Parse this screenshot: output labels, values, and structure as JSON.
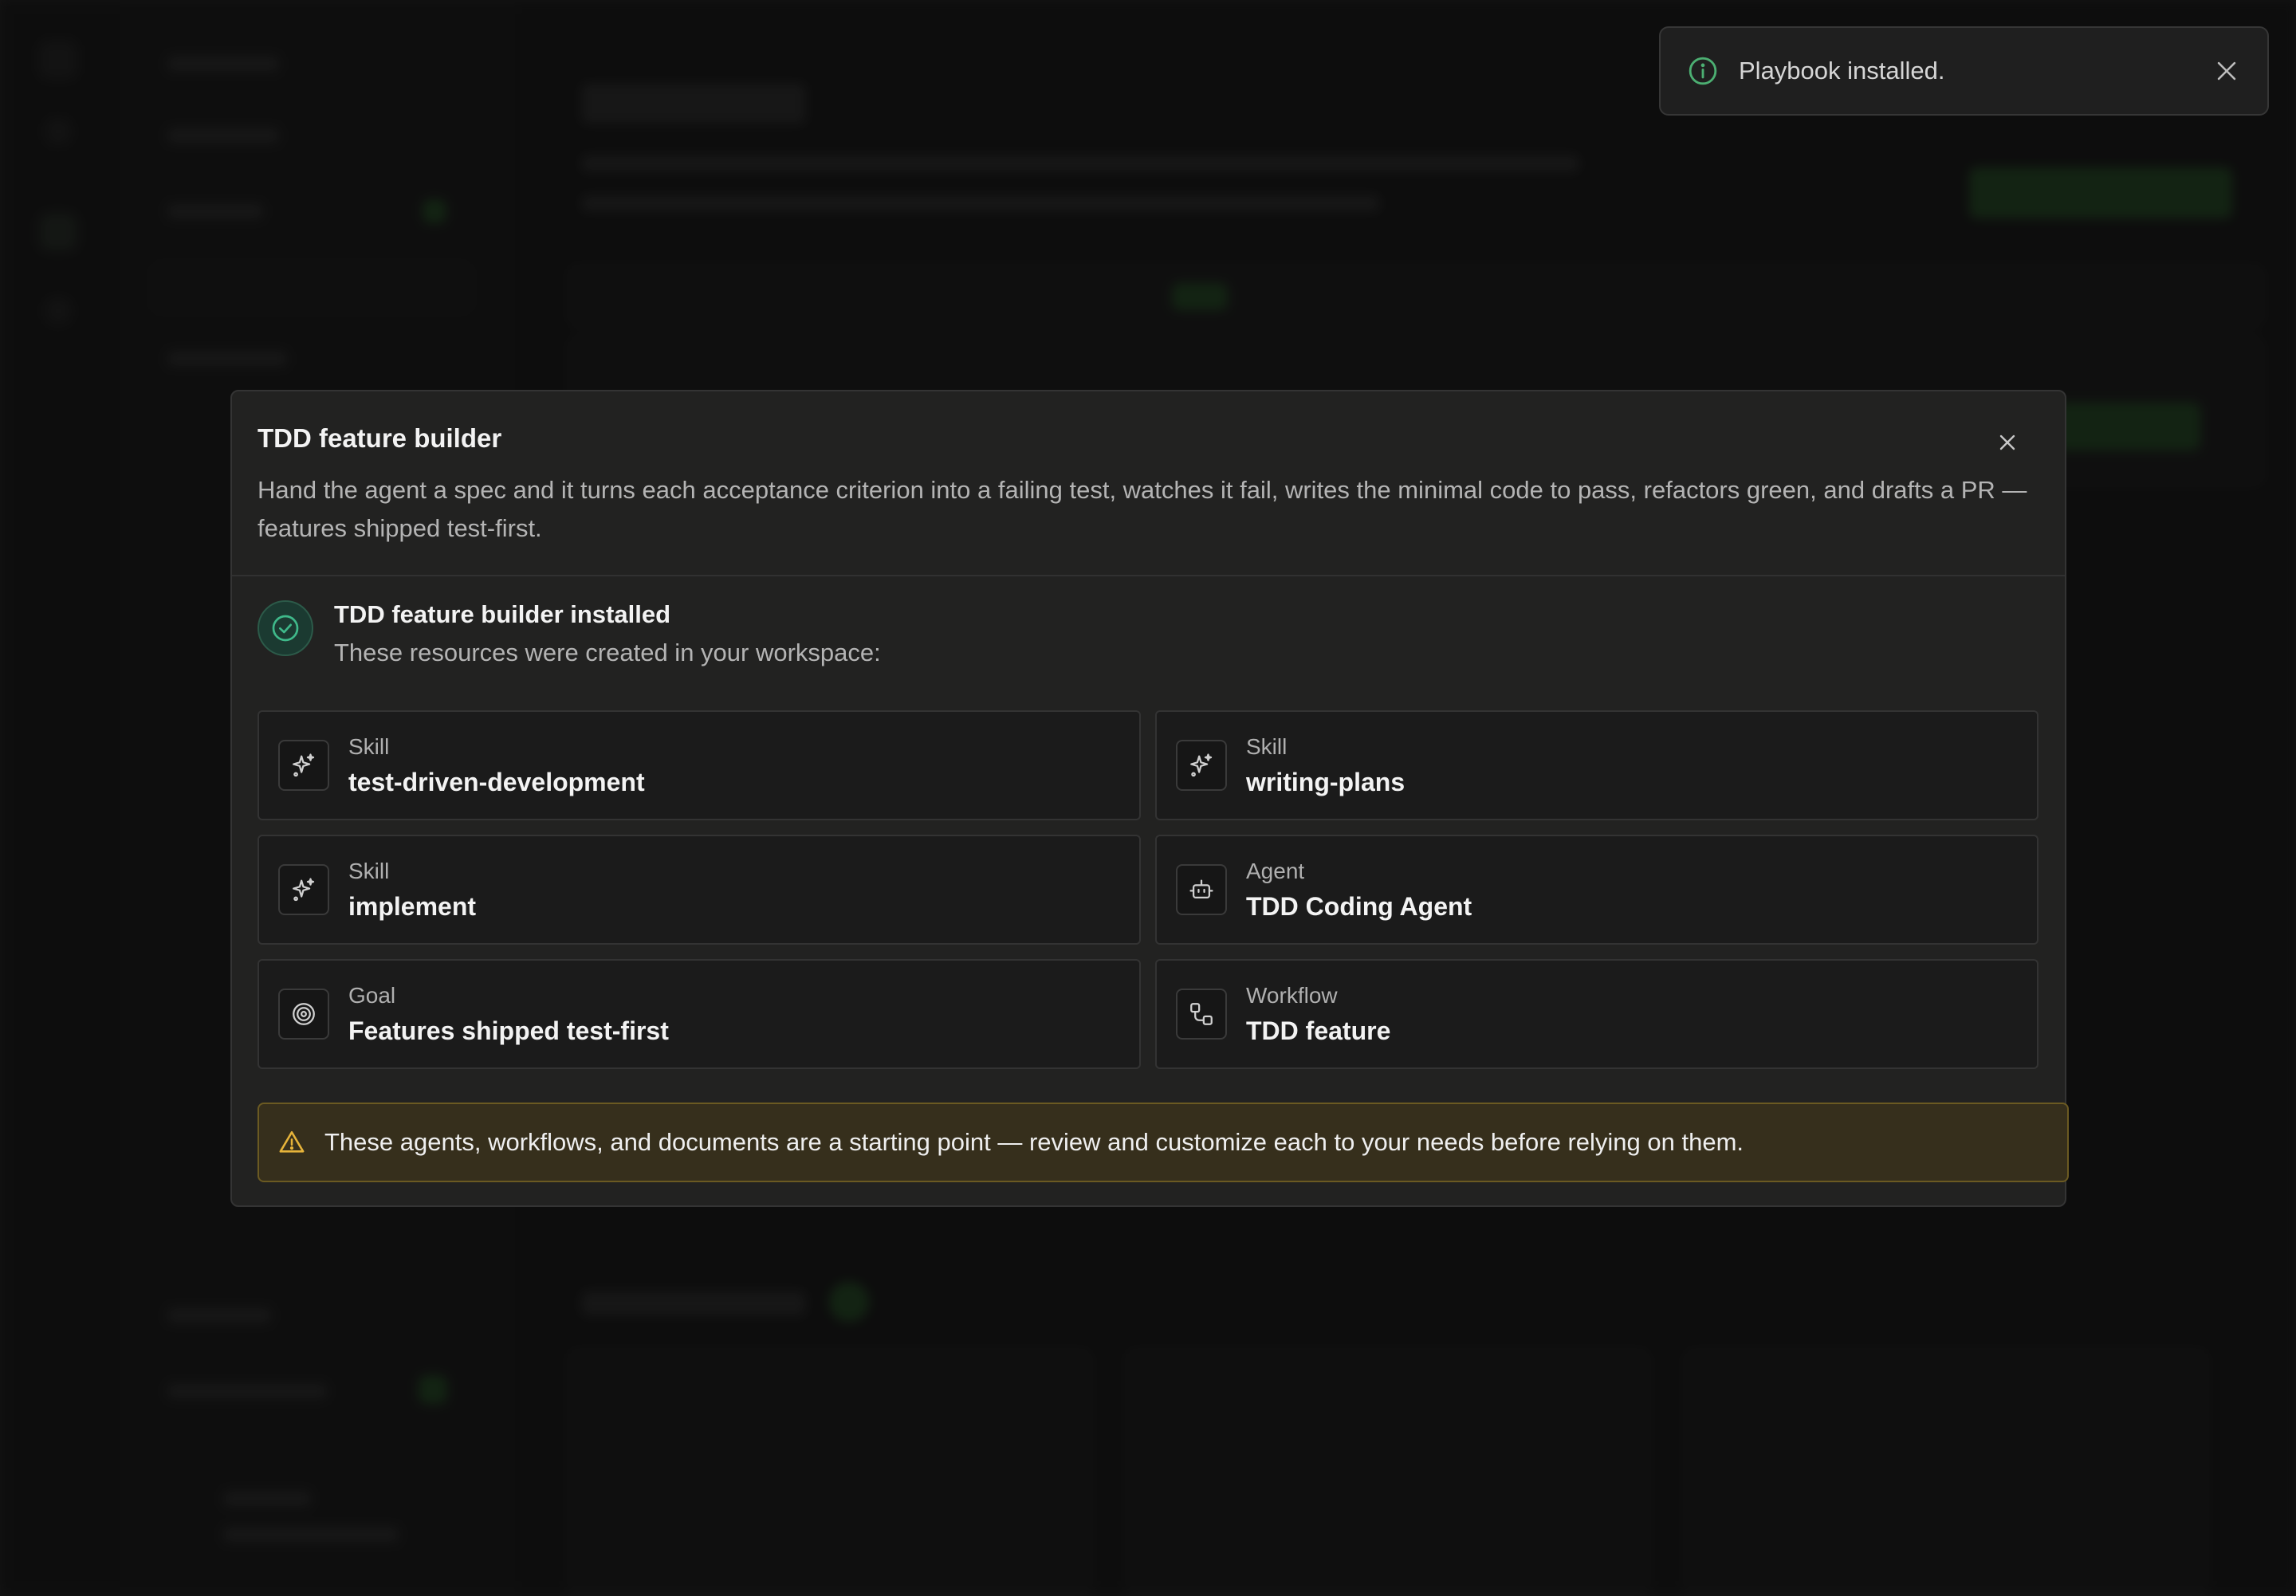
{
  "toast": {
    "message": "Playbook installed.",
    "icon": "info-icon",
    "close_icon": "close-icon"
  },
  "modal": {
    "title": "TDD feature builder",
    "description": "Hand the agent a spec and it turns each acceptance criterion into a failing test, watches it fail, writes the minimal code to pass, refactors green, and drafts a PR — features shipped test-first.",
    "installed": {
      "title": "TDD feature builder installed",
      "subtitle": "These resources were created in your workspace:"
    },
    "resources": [
      {
        "kind": "Skill",
        "name": "test-driven-development",
        "icon": "sparkle-icon"
      },
      {
        "kind": "Skill",
        "name": "writing-plans",
        "icon": "sparkle-icon"
      },
      {
        "kind": "Skill",
        "name": "implement",
        "icon": "sparkle-icon"
      },
      {
        "kind": "Agent",
        "name": "TDD Coding Agent",
        "icon": "robot-icon"
      },
      {
        "kind": "Goal",
        "name": "Features shipped test-first",
        "icon": "target-icon"
      },
      {
        "kind": "Workflow",
        "name": "TDD feature",
        "icon": "workflow-icon"
      }
    ],
    "warning": "These agents, workflows, and documents are a starting point — review and customize each to your needs before relying on them."
  },
  "colors": {
    "background": "#141414",
    "modal": "#222221",
    "accent_green": "#3fb98a",
    "warning_bg": "#362f1c",
    "warning_icon": "#e7b43a",
    "toast_info": "#4caf72"
  }
}
